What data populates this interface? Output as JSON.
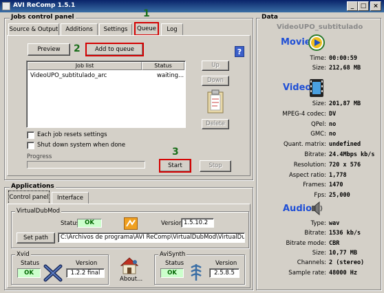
{
  "window": {
    "title": "AVI ReComp  1.5.1",
    "min": "_",
    "max": "□",
    "close": "×"
  },
  "jobs_panel": {
    "title": "Jobs control panel",
    "tabs": [
      {
        "label": "Source & Output"
      },
      {
        "label": "Additions"
      },
      {
        "label": "Settings"
      },
      {
        "label": "Queue"
      },
      {
        "label": "Log"
      }
    ],
    "annotations": [
      "1",
      "2",
      "3"
    ],
    "preview_label": "Preview",
    "add_to_queue_label": "Add to queue",
    "list_headers": {
      "job": "Job list",
      "status": "Status"
    },
    "jobs": [
      {
        "name": "VideoUPO_subtitulado_arc",
        "status": "waiting..."
      }
    ],
    "up_label": "Up",
    "down_label": "Down",
    "delete_label": "Delete",
    "check_reset": "Each job resets settings",
    "check_shutdown": "Shut down system when done",
    "progress_label": "Progress",
    "progress_value": 0,
    "start_label": "Start",
    "stop_label": "Stop",
    "help_glyph": "?"
  },
  "applications": {
    "title": "Applications",
    "tabs": [
      {
        "label": "Control panel"
      },
      {
        "label": "Interface"
      }
    ],
    "virtualdubmod": {
      "title": "VirtualDubMod",
      "status_label": "Status",
      "status_value": "OK",
      "version_label": "Version",
      "version_value": "1.5.10.2",
      "setpath_label": "Set path",
      "path_value": "C:\\Archivos de programa\\AVI ReComp\\VirtualDubMod\\VirtualDubMod.e"
    },
    "xvid": {
      "title": "Xvid",
      "status_label": "Status",
      "status_value": "OK",
      "version_label": "Version",
      "version_value": "1.2.2 final"
    },
    "about_label": "About...",
    "avisynth": {
      "title": "AviSynth",
      "status_label": "Status",
      "status_value": "OK",
      "version_label": "Version",
      "version_value": "2.5.8.5"
    }
  },
  "data_panel": {
    "title": "Data",
    "filename": "VideoUPO_subtitulado",
    "movie": {
      "title": "Movie",
      "rows": [
        {
          "label": "Time:",
          "value": "00:00:59"
        },
        {
          "label": "Size:",
          "value": "212,68 MB"
        }
      ]
    },
    "video": {
      "title": "Video",
      "rows": [
        {
          "label": "Size:",
          "value": "201,87 MB"
        },
        {
          "label": "MPEG-4 codec:",
          "value": "DV"
        },
        {
          "label": "QPel:",
          "value": "no"
        },
        {
          "label": "GMC:",
          "value": "no"
        },
        {
          "label": "Quant. matrix:",
          "value": "undefined"
        },
        {
          "label": "Bitrate:",
          "value": "24.4Mbps kb/s"
        },
        {
          "label": "Resolution:",
          "value": "720 x 576"
        },
        {
          "label": "Aspect ratio:",
          "value": "1,778"
        },
        {
          "label": "Frames:",
          "value": "1470"
        },
        {
          "label": "Fps:",
          "value": "25,000"
        }
      ]
    },
    "audio": {
      "title": "Audio",
      "rows": [
        {
          "label": "Type:",
          "value": "wav"
        },
        {
          "label": "Bitrate:",
          "value": "1536 kb/s"
        },
        {
          "label": "Bitrate mode:",
          "value": "CBR"
        },
        {
          "label": "Size:",
          "value": "10,77 MB"
        },
        {
          "label": "Channels:",
          "value": "2 (stereo)"
        },
        {
          "label": "Sample rate:",
          "value": "48000 Hz"
        }
      ]
    }
  },
  "colors": {
    "annotation_red": "#d40000",
    "annotation_green": "#1a6e1a",
    "section_blue": "#1f4fd6"
  }
}
